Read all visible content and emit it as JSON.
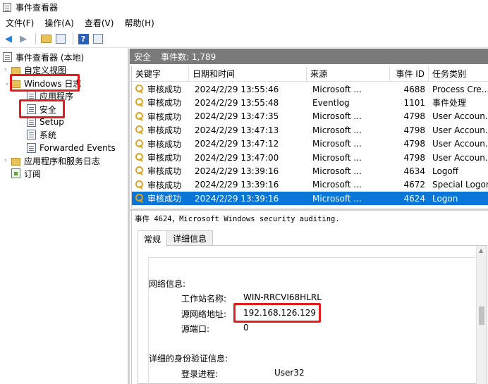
{
  "window": {
    "title": "事件查看器"
  },
  "menu": [
    "文件(F)",
    "操作(A)",
    "查看(V)",
    "帮助(H)"
  ],
  "toolbar": {
    "icons": [
      "back-arrow-icon",
      "forward-arrow-icon",
      "folder-up-icon",
      "console-tree-icon",
      "help-icon",
      "properties-icon"
    ],
    "help_glyph": "?"
  },
  "tree": {
    "root": "事件查看器 (本地)",
    "custom_views": "自定义视图",
    "windows_logs": "Windows 日志",
    "application": "应用程序",
    "security": "安全",
    "setup": "Setup",
    "system": "系统",
    "forwarded": "Forwarded Events",
    "app_services": "应用程序和服务日志",
    "subscriptions": "订阅"
  },
  "pane": {
    "title": "安全",
    "event_count": "事件数: 1,789"
  },
  "table": {
    "headers": [
      "关键字",
      "日期和时间",
      "来源",
      "事件 ID",
      "任务类别"
    ],
    "rows": [
      [
        "审核成功",
        "2024/2/29 13:55:46",
        "Microsoft ...",
        "4688",
        "Process Cre..."
      ],
      [
        "审核成功",
        "2024/2/29 13:55:48",
        "Eventlog",
        "1101",
        "事件处理"
      ],
      [
        "审核成功",
        "2024/2/29 13:47:35",
        "Microsoft ...",
        "4798",
        "User Accoun..."
      ],
      [
        "审核成功",
        "2024/2/29 13:47:13",
        "Microsoft ...",
        "4798",
        "User Accoun..."
      ],
      [
        "审核成功",
        "2024/2/29 13:47:12",
        "Microsoft ...",
        "4798",
        "User Accoun..."
      ],
      [
        "审核成功",
        "2024/2/29 13:47:00",
        "Microsoft ...",
        "4798",
        "User Accoun..."
      ],
      [
        "审核成功",
        "2024/2/29 13:39:16",
        "Microsoft ...",
        "4634",
        "Logoff"
      ],
      [
        "审核成功",
        "2024/2/29 13:39:16",
        "Microsoft ...",
        "4672",
        "Special Logon"
      ],
      [
        "审核成功",
        "2024/2/29 13:39:16",
        "Microsoft ...",
        "4624",
        "Logon"
      ]
    ],
    "selected_row": 8
  },
  "detail": {
    "title": "事件 4624，Microsoft Windows security auditing.",
    "tabs": [
      "常规",
      "详细信息"
    ],
    "clipped_top": "· · · · · · · · · · · · · · · ·",
    "network_info_label": "网络信息:",
    "workstation_label": "工作站名称:",
    "workstation_value": "WIN-RRCVI68HLRL",
    "source_addr_label": "源网络地址:",
    "source_addr_value": "192.168.126.129",
    "source_port_label": "源端口:",
    "source_port_value": "0",
    "auth_info_label": "详细的身份验证信息:",
    "logon_process_label": "登录进程:",
    "logon_process_value": "User32"
  },
  "colors": {
    "highlight": "#e51c1c",
    "selection": "#0a76d8",
    "pane_header": "#7a7a7a"
  }
}
